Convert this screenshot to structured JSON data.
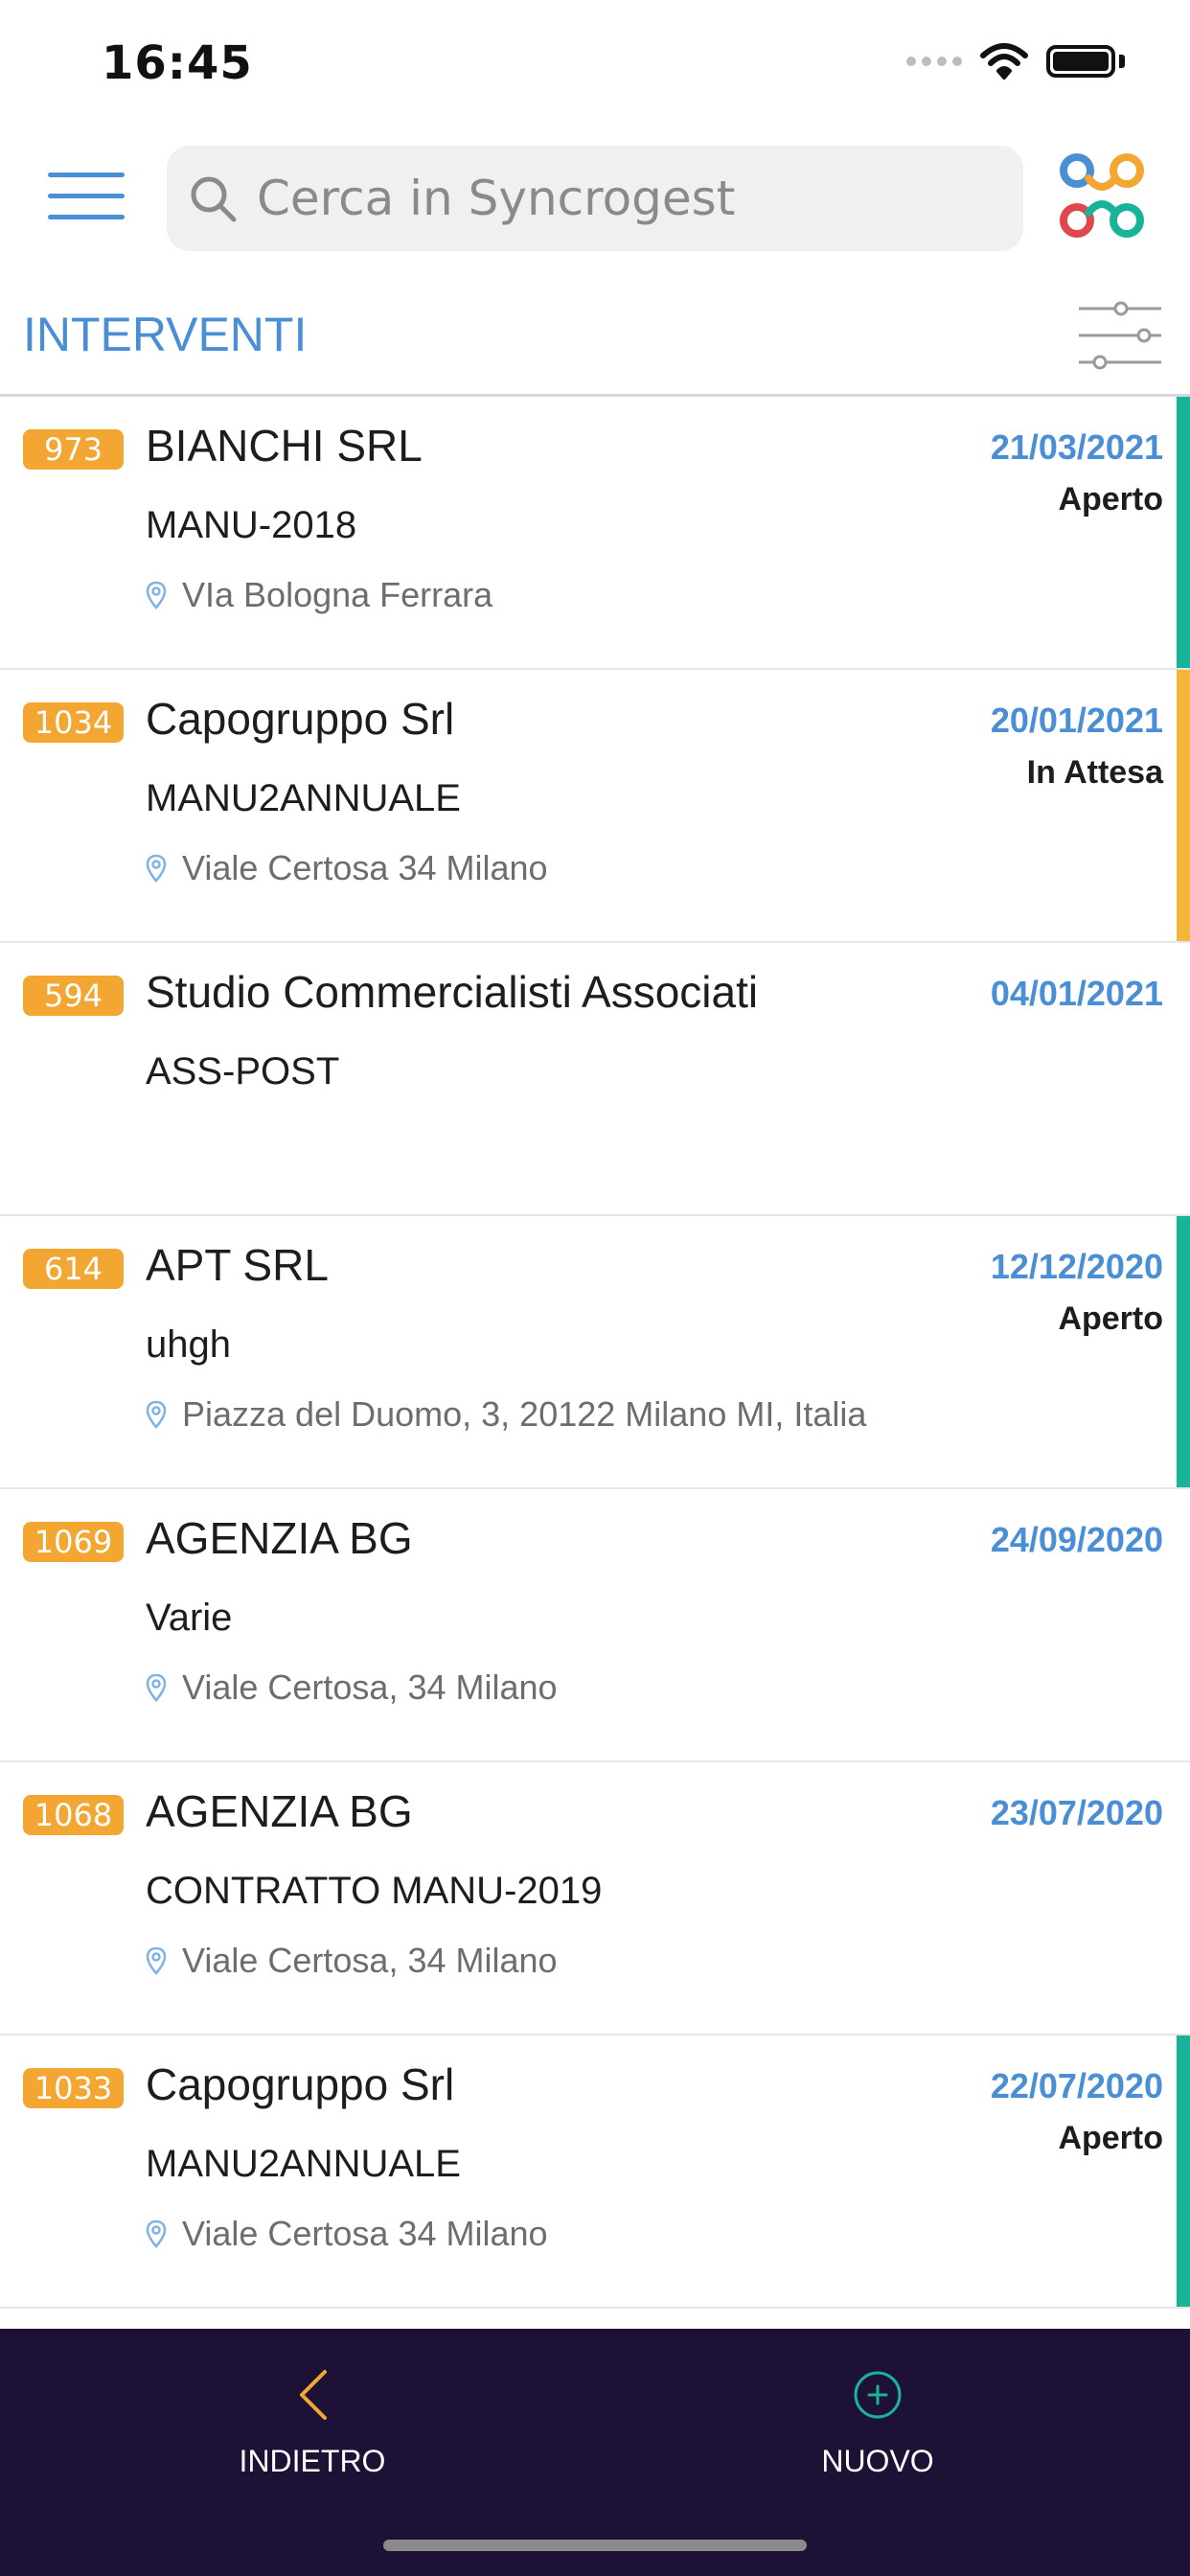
{
  "status_bar": {
    "time": "16:45"
  },
  "search": {
    "placeholder": "Cerca in Syncrogest"
  },
  "section": {
    "title": "INTERVENTI"
  },
  "items": [
    {
      "id": "973",
      "company": "BIANCHI SRL",
      "code": "MANU-2018",
      "address": "VIa Bologna Ferrara",
      "date": "21/03/2021",
      "status": "Aperto",
      "status_color": "#19b39a"
    },
    {
      "id": "1034",
      "company": "Capogruppo Srl",
      "code": "MANU2ANNUALE",
      "address": "Viale Certosa 34 Milano",
      "date": "20/01/2021",
      "status": "In Attesa",
      "status_color": "#f3b53b"
    },
    {
      "id": "594",
      "company": "Studio Commercialisti Associati",
      "code": "ASS-POST",
      "address": "",
      "date": "04/01/2021",
      "status": "",
      "status_color": ""
    },
    {
      "id": "614",
      "company": "APT SRL",
      "code": "uhgh",
      "address": "Piazza del Duomo, 3, 20122 Milano MI, Italia",
      "date": "12/12/2020",
      "status": "Aperto",
      "status_color": "#19b39a"
    },
    {
      "id": "1069",
      "company": "AGENZIA BG",
      "code": "Varie",
      "address": "Viale Certosa, 34  Milano",
      "date": "24/09/2020",
      "status": "",
      "status_color": ""
    },
    {
      "id": "1068",
      "company": "AGENZIA BG",
      "code": "CONTRATTO MANU-2019",
      "address": "Viale Certosa, 34  Milano",
      "date": "23/07/2020",
      "status": "",
      "status_color": ""
    },
    {
      "id": "1033",
      "company": "Capogruppo Srl",
      "code": "MANU2ANNUALE",
      "address": "Viale Certosa 34 Milano",
      "date": "22/07/2020",
      "status": "Aperto",
      "status_color": "#19b39a"
    }
  ],
  "bottom_nav": {
    "back_label": "INDIETRO",
    "new_label": "NUOVO"
  },
  "colors": {
    "accent": "#4a8fd6",
    "badge": "#f3a632",
    "bottom_bar": "#1e1136"
  }
}
